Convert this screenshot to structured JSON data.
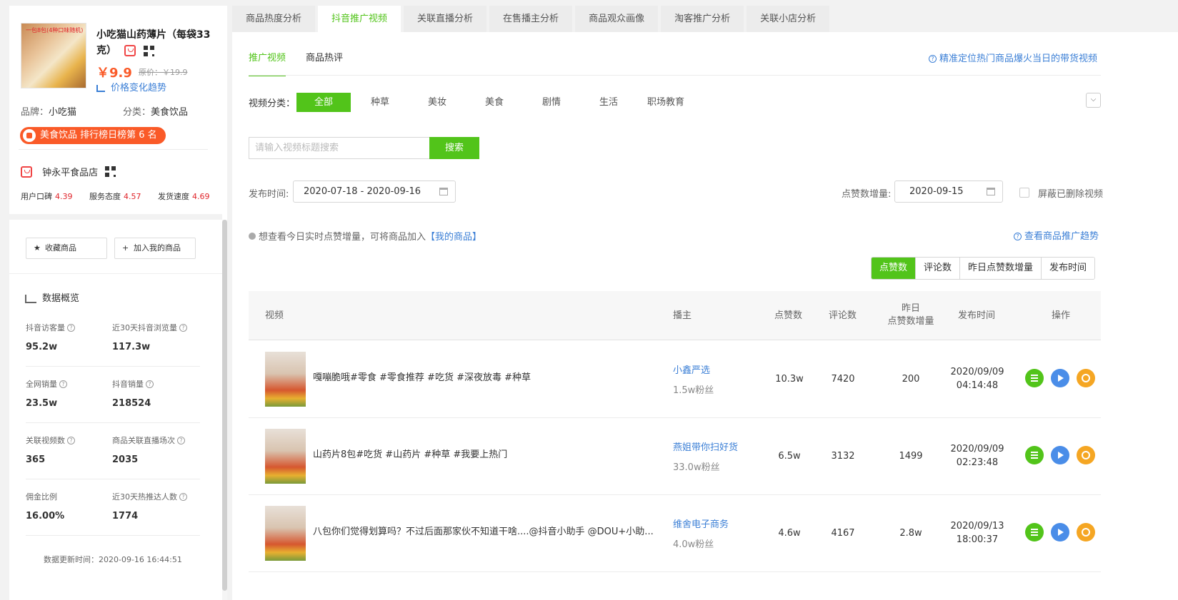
{
  "product": {
    "thumb_tag": "一包8包(4种口味随机)",
    "title": "小吃猫山药薄片（每袋33克）",
    "price": "￥9.9",
    "original_price": "原价：￥19.9",
    "price_trend": "价格变化趋势",
    "brand_label": "品牌：",
    "brand": "小吃猫",
    "category_label": "分类：",
    "category": "美食饮品",
    "rank_badge": "美食饮品 排行榜日榜第 6 名"
  },
  "store": {
    "name": "钟永平食品店",
    "scores": [
      {
        "label": "用户口碑",
        "value": "4.39"
      },
      {
        "label": "服务态度",
        "value": "4.57"
      },
      {
        "label": "发货速度",
        "value": "4.69"
      }
    ]
  },
  "actions": {
    "favorite": "收藏商品",
    "add_mine": "加入我的商品"
  },
  "overview": {
    "title": "数据概览",
    "stats": [
      {
        "label": "抖音访客量",
        "value": "95.2w"
      },
      {
        "label": "近30天抖音浏览量",
        "value": "117.3w"
      },
      {
        "label": "全网销量",
        "value": "23.5w"
      },
      {
        "label": "抖音销量",
        "value": "218524"
      },
      {
        "label": "关联视频数",
        "value": "365"
      },
      {
        "label": "商品关联直播场次",
        "value": "2035"
      },
      {
        "label": "佣金比例",
        "value": "16.00%"
      },
      {
        "label": "近30天热推达人数",
        "value": "1774"
      }
    ],
    "update_time": "数据更新时间：2020-09-16 16:44:51"
  },
  "tabs": [
    "商品热度分析",
    "抖音推广视频",
    "关联直播分析",
    "在售播主分析",
    "商品观众画像",
    "淘客推广分析",
    "关联小店分析"
  ],
  "subtabs": [
    "推广视频",
    "商品热评"
  ],
  "help_top": "精准定位热门商品爆火当日的带货视频",
  "category_filter": {
    "label": "视频分类：",
    "items": [
      "全部",
      "种草",
      "美妆",
      "美食",
      "剧情",
      "生活",
      "职场教育"
    ]
  },
  "search": {
    "placeholder": "请输入视频标题搜索",
    "button": "搜索"
  },
  "filters": {
    "publish_label": "发布时间:",
    "publish_range": "2020-07-18 - 2020-09-16",
    "likes_label": "点赞数增量:",
    "likes_date": "2020-09-15",
    "hide_deleted": "屏蔽已删除视频"
  },
  "tip": {
    "text": "想查看今日实时点赞增量，可将商品加入",
    "link": "【我的商品】",
    "trend_link": "查看商品推广趋势"
  },
  "sort_buttons": [
    "点赞数",
    "评论数",
    "昨日点赞数增量",
    "发布时间"
  ],
  "table": {
    "headers": {
      "video": "视频",
      "anchor": "播主",
      "likes": "点赞数",
      "comments": "评论数",
      "yesterday_1": "昨日",
      "yesterday_2": "点赞数增量",
      "publish": "发布时间",
      "ops": "操作"
    },
    "rows": [
      {
        "title": "嘎嘣脆哦#零食 #零食推荐 #吃货 #深夜放毒 #种草",
        "anchor": "小鑫严选",
        "fans": "1.5w粉丝",
        "likes": "10.3w",
        "comments": "7420",
        "inc": "200",
        "date": "2020/09/09",
        "time": "04:14:48"
      },
      {
        "title": "山药片8包#吃货 #山药片 #种草 #我要上热门",
        "anchor": "燕姐带你扫好货",
        "fans": "33.0w粉丝",
        "likes": "6.5w",
        "comments": "3132",
        "inc": "1499",
        "date": "2020/09/09",
        "time": "02:23:48"
      },
      {
        "title": "八包你们觉得划算吗？不过后面那家伙不知道干啥....@抖音小助手 @DOU+小助...",
        "anchor": "维舍电子商务",
        "fans": "4.0w粉丝",
        "likes": "4.6w",
        "comments": "4167",
        "inc": "2.8w",
        "date": "2020/09/13",
        "time": "18:00:37"
      }
    ]
  }
}
